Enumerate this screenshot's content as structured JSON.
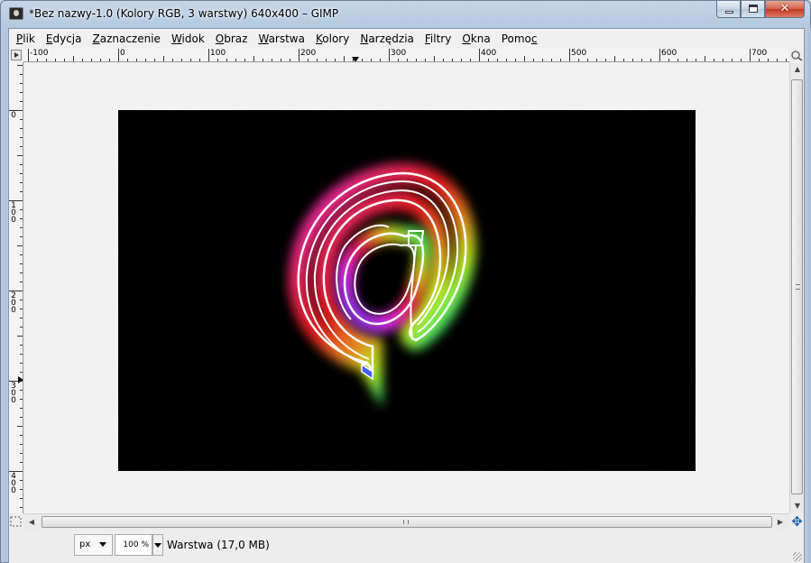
{
  "window": {
    "title": "*Bez nazwy-1.0 (Kolory RGB, 3 warstwy) 640x400 – GIMP",
    "close_glyph": "✕"
  },
  "menu": [
    {
      "label_u": "P",
      "label_rest": "lik"
    },
    {
      "label_u": "E",
      "label_rest": "dycja"
    },
    {
      "label_u": "Z",
      "label_rest": "aznaczenie"
    },
    {
      "label_u": "W",
      "label_rest": "idok"
    },
    {
      "label_u": "O",
      "label_rest": "braz"
    },
    {
      "label_u": "W",
      "label_rest": "arstwa"
    },
    {
      "label_u": "K",
      "label_rest": "olory"
    },
    {
      "label_u": "N",
      "label_rest": "arzędzia"
    },
    {
      "label_u": "F",
      "label_rest": "iltry"
    },
    {
      "label_u": "O",
      "label_rest": "kna"
    },
    {
      "label_pre": "Pomo",
      "label_u": "c",
      "label_rest": ""
    }
  ],
  "ruler": {
    "h_labels": [
      "-100",
      "0",
      "100",
      "200",
      "300",
      "400",
      "500",
      "600",
      "700"
    ],
    "v_labels": [
      "0",
      "100",
      "200",
      "300",
      "400"
    ]
  },
  "status": {
    "unit": "px",
    "zoom": "100 %",
    "layer_info": "Warstwa (17,0 MB)"
  },
  "image": {
    "content_icon": "neon-at-sign-icon",
    "background": "#000000"
  }
}
